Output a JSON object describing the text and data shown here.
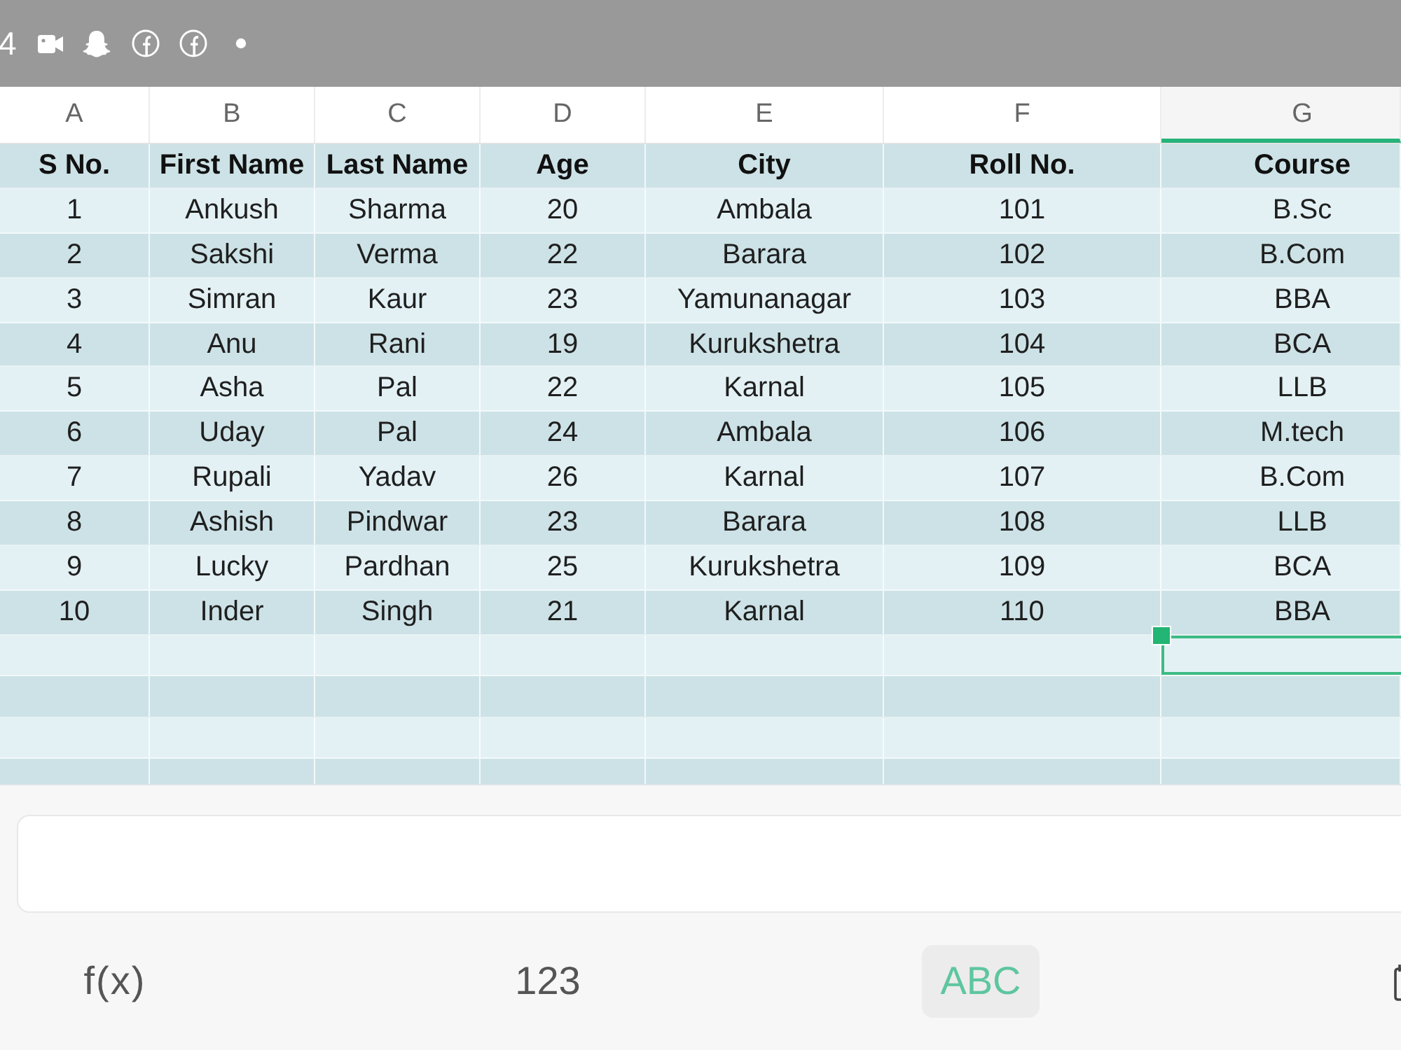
{
  "status_bar": {
    "time": "4"
  },
  "sheet": {
    "columns": [
      {
        "label": "A",
        "selected": false
      },
      {
        "label": "B",
        "selected": false
      },
      {
        "label": "C",
        "selected": false
      },
      {
        "label": "D",
        "selected": false
      },
      {
        "label": "E",
        "selected": false
      },
      {
        "label": "F",
        "selected": false
      },
      {
        "label": "G",
        "selected": true
      }
    ],
    "rows": [
      {
        "kind": "header",
        "selected": false,
        "cells": [
          "S No.",
          "First Name",
          "Last Name",
          "Age",
          "City",
          "Roll No.",
          "Course"
        ]
      },
      {
        "kind": "data",
        "selected": false,
        "cells": [
          "1",
          "Ankush",
          "Sharma",
          "20",
          "Ambala",
          "101",
          "B.Sc"
        ]
      },
      {
        "kind": "data",
        "selected": false,
        "cells": [
          "2",
          "Sakshi",
          "Verma",
          "22",
          "Barara",
          "102",
          "B.Com"
        ]
      },
      {
        "kind": "data",
        "selected": false,
        "cells": [
          "3",
          "Simran",
          "Kaur",
          "23",
          "Yamunanagar",
          "103",
          "BBA"
        ]
      },
      {
        "kind": "data",
        "selected": false,
        "cells": [
          "4",
          "Anu",
          "Rani",
          "19",
          "Kurukshetra",
          "104",
          "BCA"
        ]
      },
      {
        "kind": "data",
        "selected": false,
        "cells": [
          "5",
          "Asha",
          "Pal",
          "22",
          "Karnal",
          "105",
          "LLB"
        ]
      },
      {
        "kind": "data",
        "selected": false,
        "cells": [
          "6",
          "Uday",
          "Pal",
          "24",
          "Ambala",
          "106",
          "M.tech"
        ]
      },
      {
        "kind": "data",
        "selected": false,
        "cells": [
          "7",
          "Rupali",
          "Yadav",
          "26",
          "Karnal",
          "107",
          "B.Com"
        ]
      },
      {
        "kind": "data",
        "selected": false,
        "cells": [
          "8",
          "Ashish",
          "Pindwar",
          "23",
          "Barara",
          "108",
          "LLB"
        ]
      },
      {
        "kind": "data",
        "selected": false,
        "cells": [
          "9",
          "Lucky",
          "Pardhan",
          "25",
          "Kurukshetra",
          "109",
          "BCA"
        ]
      },
      {
        "kind": "data",
        "selected": false,
        "cells": [
          "10",
          "Inder",
          "Singh",
          "21",
          "Karnal",
          "110",
          "BBA"
        ]
      }
    ],
    "blank_rows": [
      {
        "selected": true
      },
      {
        "selected": false
      },
      {
        "selected": false
      },
      {
        "selected": false
      }
    ]
  },
  "input_modes": [
    {
      "label": "f(x)",
      "selected": false
    },
    {
      "label": "123",
      "selected": false
    },
    {
      "label": "ABC",
      "selected": true
    }
  ]
}
